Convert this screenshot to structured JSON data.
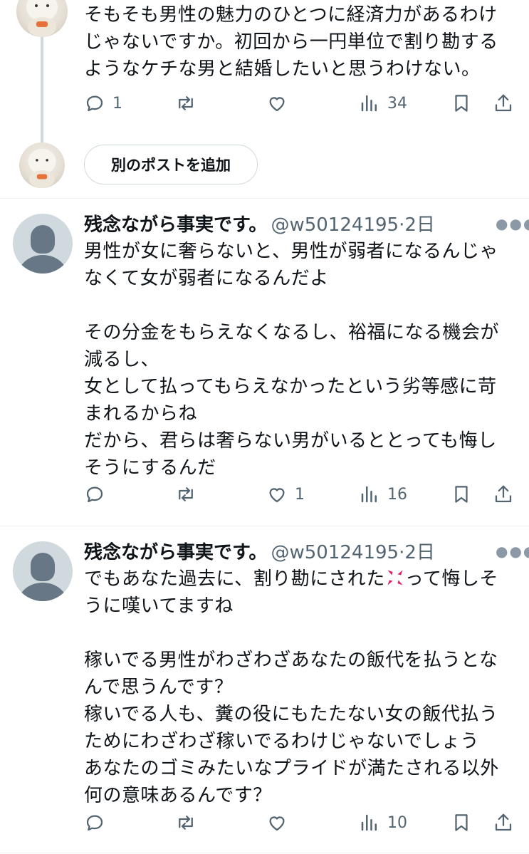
{
  "thread_top": {
    "text": "そもそも男性の魅力のひとつに経済力があるわけ\nじゃないですか。初回から一円単位で割り勘する\nようなケチな男と結婚したいと思うわけない。",
    "actions": {
      "replies": "1",
      "retweets": "",
      "likes": "",
      "views": "34"
    }
  },
  "add_post": {
    "label": "別のポストを追加"
  },
  "replies": [
    {
      "author": "残念ながら事実です。",
      "handle": "@w50124195",
      "time": "·2日",
      "text": "男性が女に奢らないと、男性が弱者になるんじゃ\nなくて女が弱者になるんだよ\n\nその分金をもらえなくなるし、裕福になる機会が\n減るし、\n女として払ってもらえなかったという劣等感に苛\nまれるからね\nだから、君らは奢らない男がいるととっても悔し\nそうにするんだ",
      "actions": {
        "replies": "",
        "retweets": "",
        "likes": "1",
        "views": "16"
      }
    },
    {
      "author": "残念ながら事実です。",
      "handle": "@w50124195",
      "time": "·2日",
      "text_before_emoji": "でもあなた過去に、割り勘にされた",
      "emoji": "anger-symbol",
      "text_after_emoji": "って悔しそ\nうに嘆いてますね\n\n稼いでる男性がわざわざあなたの飯代を払うとな\nんで思うんです？\n稼いでる人も、糞の役にもたたない女の飯代払う\nためにわざわざ稼いでるわけじゃないでしょう\nあなたのゴミみたいなプライドが満たされる以外\n何の意味あるんです？",
      "actions": {
        "replies": "",
        "retweets": "",
        "likes": "",
        "views": "10"
      }
    }
  ],
  "icons": {
    "reply": "reply-icon",
    "retweet": "retweet-icon",
    "like": "heart-icon",
    "views": "views-icon",
    "bookmark": "bookmark-icon",
    "share": "share-icon",
    "more": "more-icon"
  },
  "colors": {
    "icon": "#536471",
    "text": "#0f1419",
    "divider": "#eff3f4",
    "anger": "#e0245e"
  }
}
